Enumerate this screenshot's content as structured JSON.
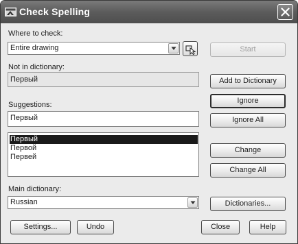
{
  "window": {
    "title": "Check Spelling",
    "app_icon": "autocad-icon",
    "close_icon": "close-icon"
  },
  "where_to_check": {
    "label": "Where to check:",
    "value": "Entire drawing",
    "select_objects_icon": "select-objects-icon"
  },
  "not_in_dictionary": {
    "label": "Not in dictionary:",
    "value": "Первый"
  },
  "suggestions": {
    "label": "Suggestions:",
    "value": "Первый",
    "items": [
      "Первый",
      "Первой",
      "Первей"
    ],
    "selected_index": 0
  },
  "main_dictionary": {
    "label": "Main dictionary:",
    "value": "Russian"
  },
  "buttons": {
    "start": "Start",
    "add_to_dictionary": "Add to Dictionary",
    "ignore": "Ignore",
    "ignore_all": "Ignore All",
    "change": "Change",
    "change_all": "Change All",
    "dictionaries": "Dictionaries...",
    "settings": "Settings...",
    "undo": "Undo",
    "close": "Close",
    "help": "Help"
  },
  "colors": {
    "titlebar": "#5c5c5c",
    "dialog_bg": "#ebebeb",
    "selection": "#1a1a1a"
  }
}
